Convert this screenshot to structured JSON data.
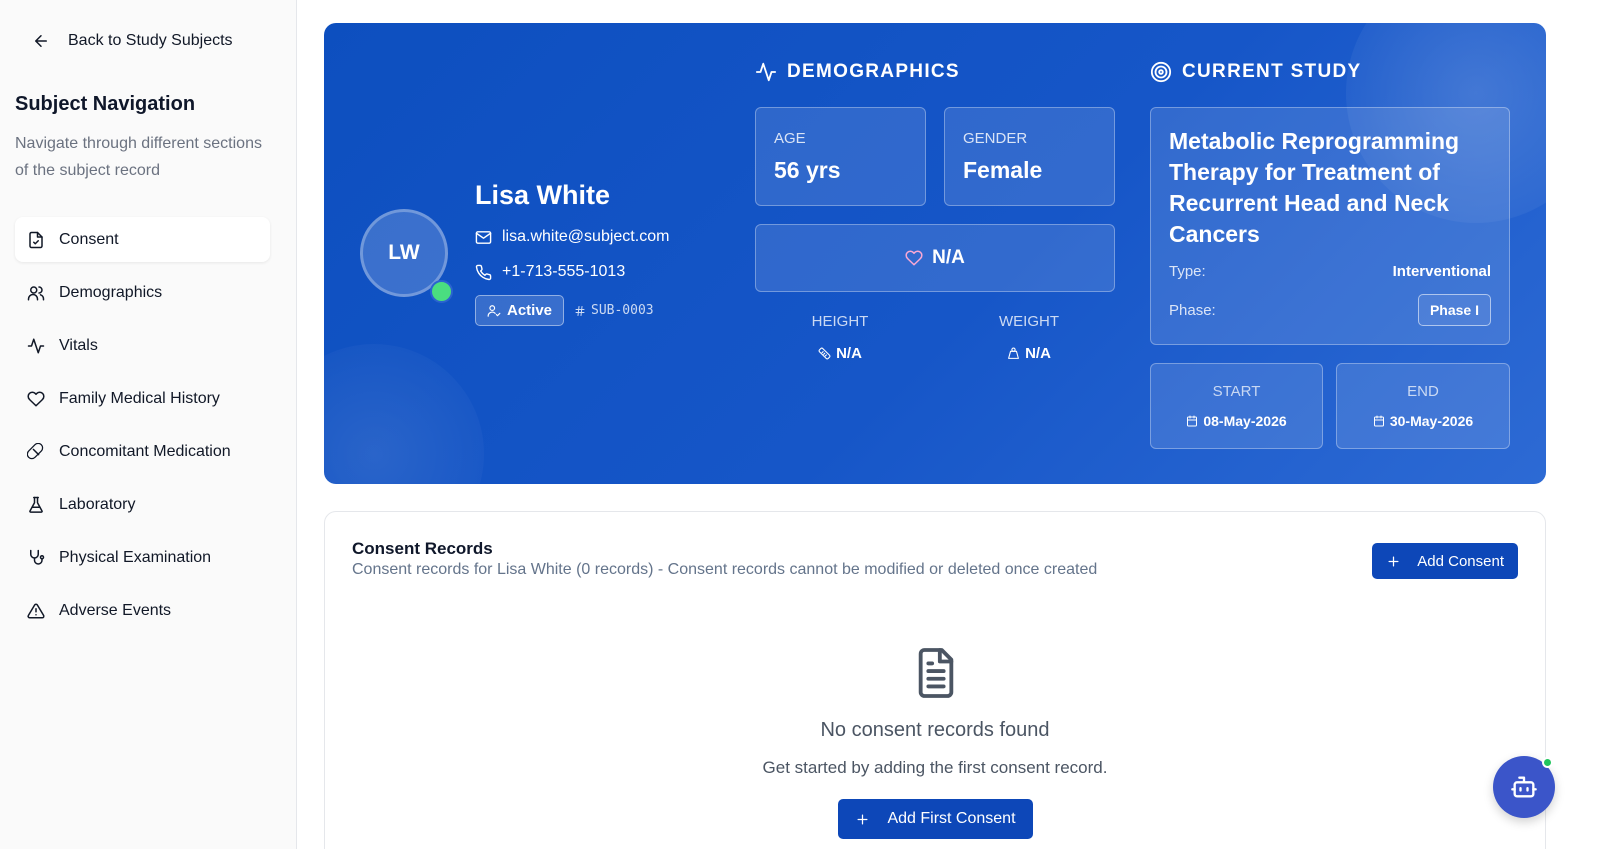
{
  "sidebar": {
    "back_label": "Back to Study Subjects",
    "title": "Subject Navigation",
    "description": "Navigate through different sections of the subject record",
    "items": [
      {
        "label": "Consent",
        "icon": "file-check-icon",
        "active": true
      },
      {
        "label": "Demographics",
        "icon": "users-icon"
      },
      {
        "label": "Vitals",
        "icon": "activity-icon"
      },
      {
        "label": "Family Medical History",
        "icon": "heart-icon"
      },
      {
        "label": "Concomitant Medication",
        "icon": "pill-icon"
      },
      {
        "label": "Laboratory",
        "icon": "flask-icon"
      },
      {
        "label": "Physical Examination",
        "icon": "stethoscope-icon"
      },
      {
        "label": "Adverse Events",
        "icon": "alert-triangle-icon"
      }
    ]
  },
  "subject": {
    "initials": "LW",
    "name": "Lisa White",
    "email": "lisa.white@subject.com",
    "phone": "+1-713-555-1013",
    "status": "Active",
    "id": "SUB-0003"
  },
  "demographics": {
    "heading": "DEMOGRAPHICS",
    "age_label": "AGE",
    "age_value": "56 yrs",
    "gender_label": "GENDER",
    "gender_value": "Female",
    "heart_value": "N/A",
    "height_label": "HEIGHT",
    "height_value": "N/A",
    "weight_label": "WEIGHT",
    "weight_value": "N/A"
  },
  "study": {
    "heading": "CURRENT STUDY",
    "title": "Metabolic Reprogramming Therapy for Treatment of Recurrent Head and Neck Cancers",
    "type_label": "Type:",
    "type_value": "Interventional",
    "phase_label": "Phase:",
    "phase_value": "Phase I",
    "start_label": "START",
    "start_value": "08-May-2026",
    "end_label": "END",
    "end_value": "30-May-2026"
  },
  "consent": {
    "title": "Consent Records",
    "subtitle": "Consent records for Lisa White (0 records) - Consent records cannot be modified or deleted once created",
    "add_label": "Add Consent",
    "empty_title": "No consent records found",
    "empty_sub": "Get started by adding the first consent record.",
    "first_label": "Add First Consent"
  },
  "colors": {
    "primary": "#0d47b8",
    "hero": "#1656c8",
    "online": "#4ade80",
    "bot": "#3b55c9"
  }
}
